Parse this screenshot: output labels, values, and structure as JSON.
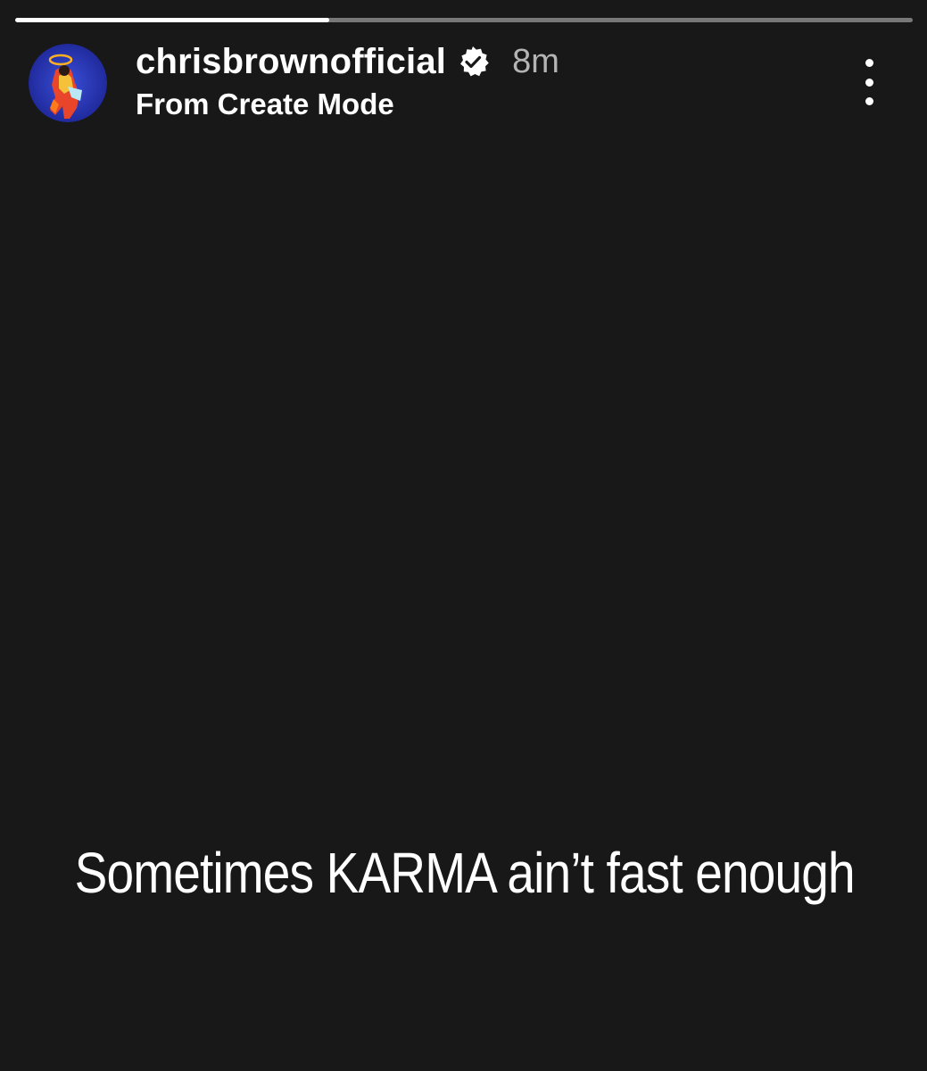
{
  "story": {
    "progress_fraction": 0.35,
    "username": "chrisbrownofficial",
    "verified": true,
    "time_ago": "8m",
    "subtitle": "From Create Mode",
    "text": "Sometimes KARMA ain’t fast enough"
  },
  "icons": {
    "verified": "verified-badge-icon",
    "more": "more-options-icon"
  },
  "colors": {
    "background": "#181818",
    "text": "#ffffff",
    "timestamp": "#b4b4b4"
  }
}
